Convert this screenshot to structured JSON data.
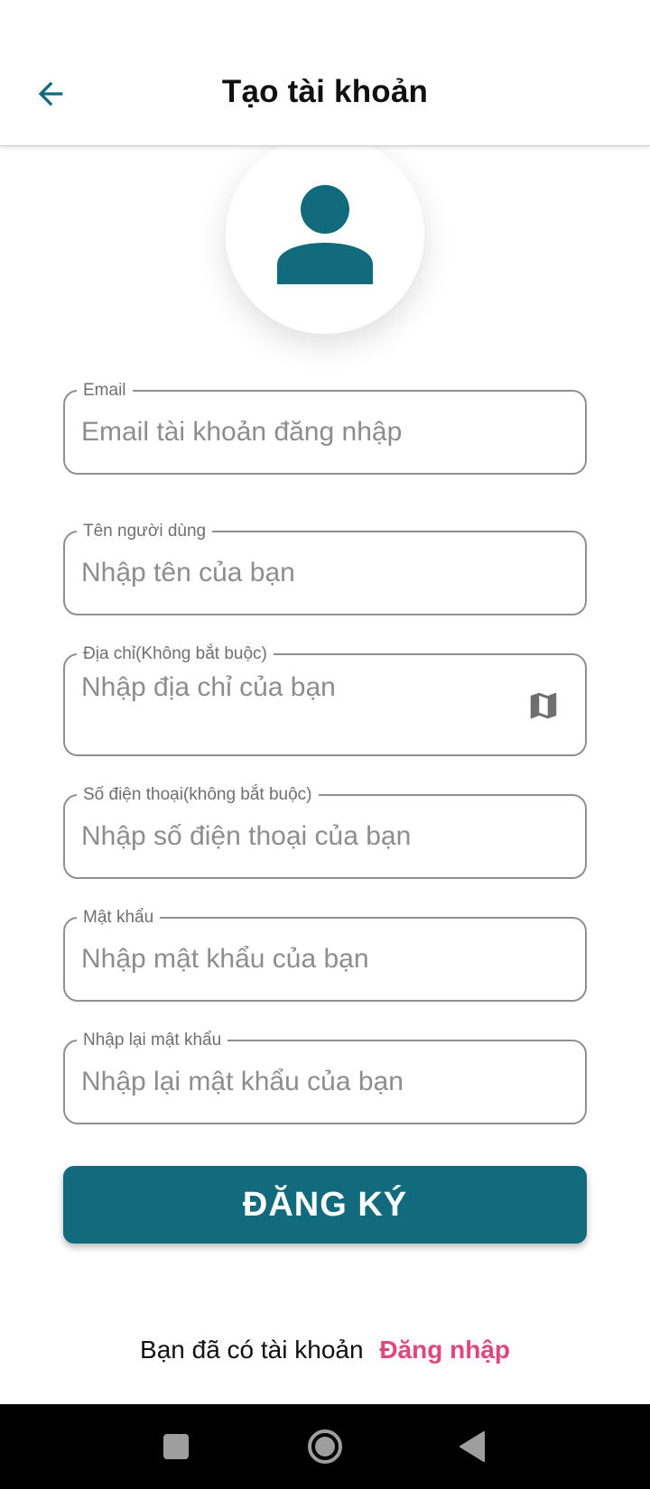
{
  "header": {
    "title": "Tạo tài khoản",
    "back_icon": "arrow-back-icon"
  },
  "avatar": {
    "icon": "person-icon"
  },
  "form": {
    "email": {
      "label": "Email",
      "placeholder": "Email tài khoản đăng nhập",
      "value": ""
    },
    "username": {
      "label": "Tên người dùng",
      "placeholder": "Nhập tên của bạn",
      "value": ""
    },
    "address": {
      "label": "Địa chỉ(Không bắt buộc)",
      "placeholder": "Nhập địa chỉ của bạn",
      "value": "",
      "icon": "map-icon"
    },
    "phone": {
      "label": "Số điện thoại(không bắt buộc)",
      "placeholder": "Nhập số điện thoại của bạn",
      "value": ""
    },
    "password": {
      "label": "Mật khẩu",
      "placeholder": "Nhập mật khẩu của bạn",
      "value": ""
    },
    "confirm_password": {
      "label": "Nhập lại mật khẩu",
      "placeholder": "Nhập lại mật khẩu của bạn",
      "value": ""
    }
  },
  "register_button": {
    "label": "ĐĂNG KÝ"
  },
  "footer": {
    "prompt": "Bạn đã có tài khoản",
    "login_link": "Đăng nhập"
  },
  "nav_bar": {
    "icons": [
      "recent-apps-icon",
      "home-icon",
      "back-icon"
    ]
  },
  "colors": {
    "primary": "#126b7c",
    "accent_link": "#e0467a",
    "field_border": "#8f8f8f",
    "placeholder": "#8d8d8d"
  }
}
